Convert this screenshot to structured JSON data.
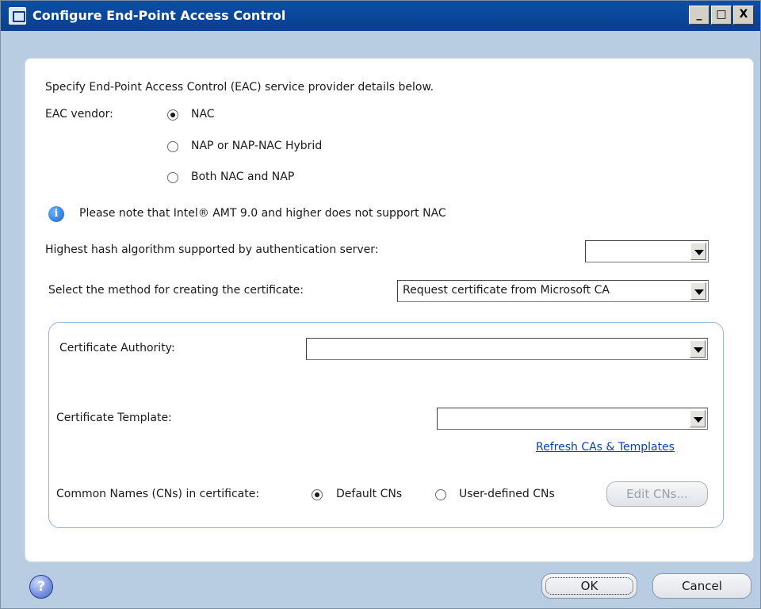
{
  "window": {
    "title": "Configure End-Point Access Control",
    "controls": {
      "minimize": "_",
      "maximize": "□",
      "close": "X"
    }
  },
  "intro": "Specify End-Point Access Control (EAC) service provider details below.",
  "vendor": {
    "label": "EAC vendor:",
    "options": [
      {
        "label": "NAC",
        "checked": true
      },
      {
        "label": "NAP or NAP-NAC Hybrid",
        "checked": false
      },
      {
        "label": "Both NAC and NAP",
        "checked": false
      }
    ]
  },
  "notice": {
    "icon": "info-icon",
    "text": "Please note that Intel® AMT 9.0 and higher does not support NAC"
  },
  "hash": {
    "label": "Highest hash algorithm supported by authentication server:",
    "value": ""
  },
  "method": {
    "label": "Select the method for creating the certificate:",
    "value": "Request certificate from Microsoft CA"
  },
  "certificate": {
    "authority_label": "Certificate Authority:",
    "authority_value": "",
    "template_label": "Certificate Template:",
    "template_value": "",
    "refresh_link": "Refresh CAs & Templates",
    "cn_label": "Common Names (CNs) in certificate:",
    "cn_options": [
      {
        "label": "Default CNs",
        "checked": true
      },
      {
        "label": "User-defined  CNs",
        "checked": false
      }
    ],
    "edit_button": "Edit CNs...",
    "edit_enabled": false
  },
  "footer": {
    "help_icon": "help-icon",
    "help_glyph": "?",
    "ok_label": "OK",
    "cancel_label": "Cancel"
  },
  "colors": {
    "titlebar": "#0a3f8c",
    "frame": "#b9cde2",
    "link": "#0a3fa8",
    "group_border": "#8eb4db"
  }
}
